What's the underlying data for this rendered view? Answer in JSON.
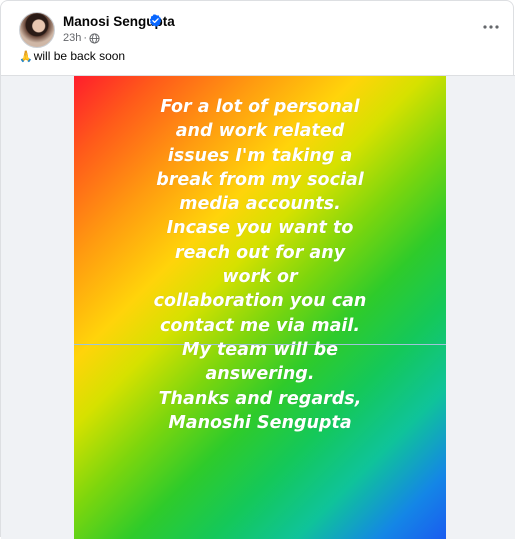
{
  "post": {
    "author_name": "Manosi Sengupta",
    "timestamp": "23h",
    "visibility_icon": "globe-icon",
    "verified_icon": "verified-badge-icon",
    "more_icon": "more-options-icon",
    "caption_emoji": "🙏",
    "caption_text": "will be back soon",
    "image_text_lines": [
      "For a lot of personal",
      "and work related",
      "issues I'm taking a",
      "break from my social",
      "media accounts.",
      "Incase you want to",
      "reach out for any",
      "work or",
      "collaboration you can",
      "contact me via mail.",
      "My team will be",
      "answering.",
      "Thanks and regards,",
      "Manoshi Sengupta"
    ]
  },
  "colors": {
    "verified_blue": "#0866ff",
    "secondary_text": "#65676b",
    "primary_text": "#050505"
  }
}
